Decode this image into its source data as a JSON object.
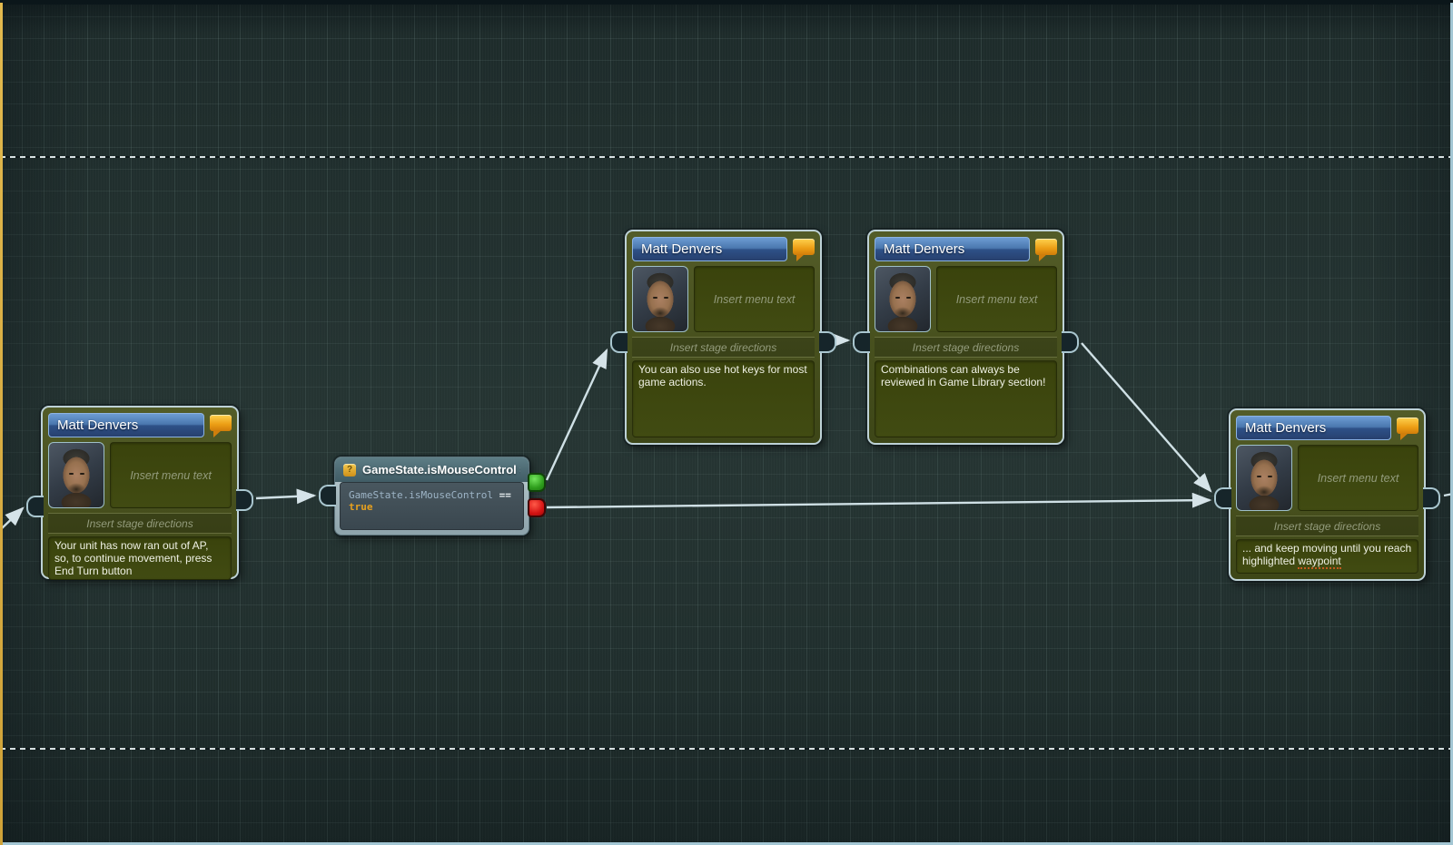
{
  "app": {
    "type": "dialogue-flow-editor"
  },
  "placeholders": {
    "menu": "Insert menu text",
    "stage": "Insert stage directions"
  },
  "character": {
    "name": "Matt Denvers"
  },
  "dialogue_nodes": [
    {
      "title": "Matt Denvers",
      "body": "Your unit has now ran out of AP, so, to continue movement, press End Turn button"
    },
    {
      "title": "Matt Denvers",
      "body": "You can also use hot keys for most game actions."
    },
    {
      "title": "Matt Denvers",
      "body": "Combinations can always be reviewed in Game Library section!"
    },
    {
      "title": "Matt Denvers",
      "body_prefix": "... and keep moving until you reach highlighted ",
      "body_underlined": "waypoint"
    }
  ],
  "condition_node": {
    "icon_glyph": "?",
    "title": "GameState.isMouseControl ==…",
    "expression": {
      "lhs": "GameState.isMouseControl",
      "operator": "==",
      "rhs": "true"
    }
  },
  "colors": {
    "canvas_bg": "#1f2d2c",
    "grid_line": "#3e4e4c",
    "title_bar_blue": "#3d6398",
    "node_olive": "#49521f",
    "bubble_icon_orange": "#eb9d14",
    "condition_frame": "#a9bcc2",
    "condition_header": "#4b6871",
    "code_lhs_blue": "#9db4c6",
    "code_value_orange": "#e7a01e",
    "pin_true_green": "#2f9e1d",
    "pin_false_red": "#d51414",
    "arrow": "#cfe0e5",
    "left_edge_yellow": "#d3a93f",
    "frame_edge_blue": "#a3c6d3",
    "spellcheck_underline": "#c25a20"
  }
}
